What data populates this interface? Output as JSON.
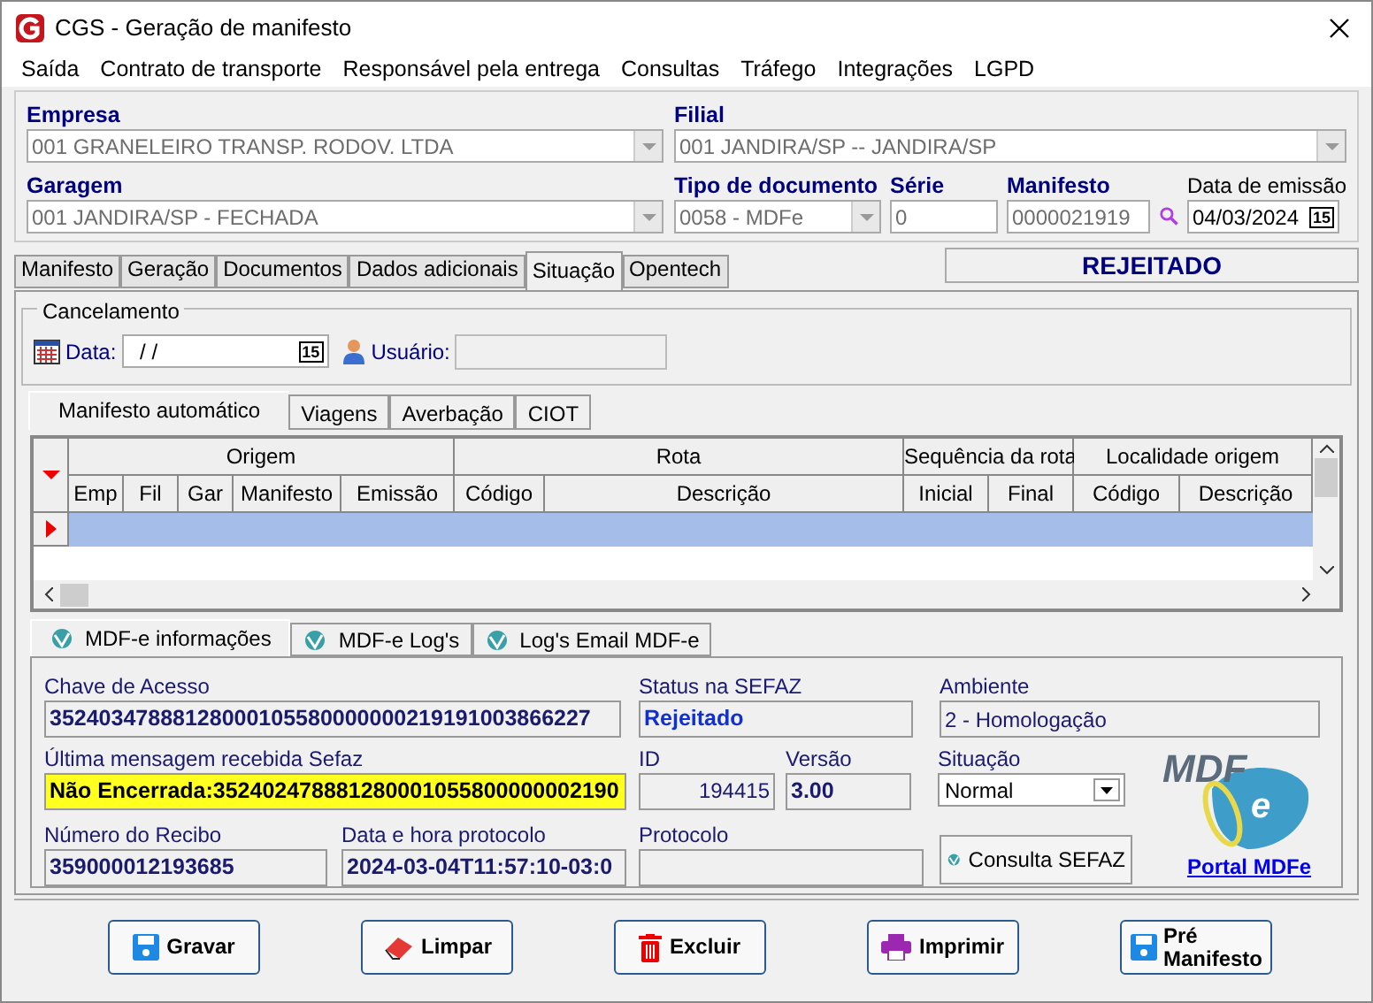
{
  "window": {
    "title": "CGS - Geração de manifesto"
  },
  "menu": [
    "Saída",
    "Contrato de transporte",
    "Responsável pela entrega",
    "Consultas",
    "Tráfego",
    "Integrações",
    "LGPD"
  ],
  "header": {
    "empresa": {
      "label": "Empresa",
      "value": "001 GRANELEIRO TRANSP. RODOV. LTDA",
      "disabled": true
    },
    "filial": {
      "label": "Filial",
      "value": "001 JANDIRA/SP -- JANDIRA/SP",
      "disabled": true
    },
    "garagem": {
      "label": "Garagem",
      "value": "001 JANDIRA/SP - FECHADA",
      "disabled": true
    },
    "tipo_documento": {
      "label": "Tipo de documento",
      "value": "0058 - MDFe",
      "disabled": true
    },
    "serie": {
      "label": "Série",
      "value": "0",
      "disabled": true
    },
    "manifesto": {
      "label": "Manifesto",
      "value": "0000021919",
      "disabled": true
    },
    "data_emissao": {
      "label": "Data de emissão",
      "value": "04/03/2024",
      "calendar": "15"
    }
  },
  "status_banner": "REJEITADO",
  "tabs": [
    {
      "label": "Manifesto",
      "selected": false
    },
    {
      "label": "Geração",
      "selected": false
    },
    {
      "label": "Documentos",
      "selected": false
    },
    {
      "label": "Dados adicionais",
      "selected": false
    },
    {
      "label": "Situação",
      "selected": true
    },
    {
      "label": "Opentech",
      "selected": false
    }
  ],
  "cancelamento": {
    "title": "Cancelamento",
    "data_label": "Data:",
    "data_value": " / /",
    "calendar": "15",
    "usuario_label": "Usuário:"
  },
  "inner_tabs": [
    {
      "label": "Manifesto automático",
      "selected": true
    },
    {
      "label": "Viagens",
      "selected": false
    },
    {
      "label": "Averbação",
      "selected": false
    },
    {
      "label": "CIOT",
      "selected": false
    }
  ],
  "grid": {
    "groups": [
      {
        "label": "Origem",
        "columns": [
          "Emp",
          "Fil",
          "Gar",
          "Manifesto",
          "Emissão"
        ]
      },
      {
        "label": "Rota",
        "columns": [
          "Código",
          "Descrição"
        ]
      },
      {
        "label": "Sequência da rota",
        "columns": [
          "Inicial",
          "Final"
        ]
      },
      {
        "label": "Localidade origem",
        "columns": [
          "Código",
          "Descrição"
        ]
      }
    ],
    "rows": [
      {
        "selected": true
      }
    ]
  },
  "mdfe_tabs": [
    {
      "label": "MDF-e informações",
      "selected": true
    },
    {
      "label": "MDF-e Log's",
      "selected": false
    },
    {
      "label": "Log's Email MDF-e",
      "selected": false
    }
  ],
  "info": {
    "chave": {
      "label": "Chave de Acesso",
      "value": "35240347888128000105580000000219191003866227"
    },
    "status": {
      "label": "Status na SEFAZ",
      "value": "Rejeitado"
    },
    "ambiente": {
      "label": "Ambiente",
      "value": "2 - Homologação"
    },
    "ultima_mensagem": {
      "label": "Última mensagem recebida Sefaz",
      "value": "Não Encerrada:352402478881280001055800000002190",
      "highlighted": true
    },
    "id": {
      "label": "ID",
      "value": "194415"
    },
    "versao": {
      "label": "Versão",
      "value": "3.00"
    },
    "situacao": {
      "label": "Situação",
      "value": "Normal"
    },
    "numero_recibo": {
      "label": "Número do Recibo",
      "value": "359000012193685"
    },
    "data_hora_protocolo": {
      "label": "Data e hora protocolo",
      "value": "2024-03-04T11:57:10-03:0"
    },
    "protocolo": {
      "label": "Protocolo"
    },
    "consulta_button": "Consulta SEFAZ",
    "logo": {
      "text": "MDF",
      "suffix": "e"
    },
    "portal_link": "Portal MDFe"
  },
  "buttons": [
    {
      "kind": "save",
      "label": "Gravar"
    },
    {
      "kind": "clear",
      "label": "Limpar"
    },
    {
      "kind": "delete",
      "label": "Excluir"
    },
    {
      "kind": "print",
      "label": "Imprimir"
    },
    {
      "kind": "save",
      "label": "Pré Manifesto"
    }
  ]
}
